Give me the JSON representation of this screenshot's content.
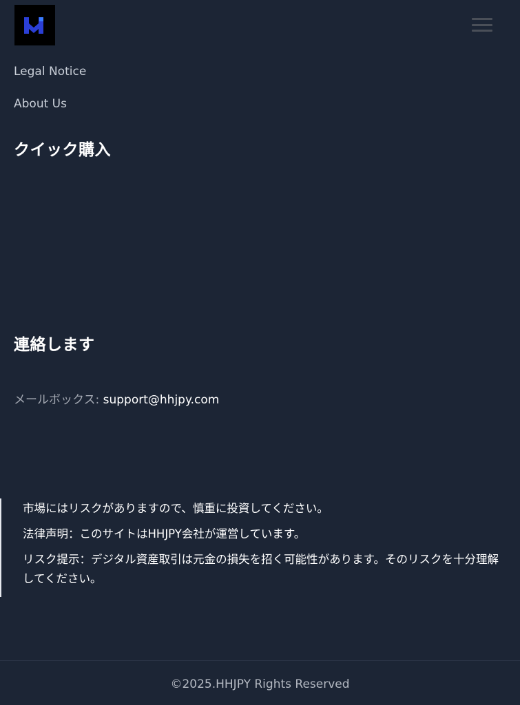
{
  "header": {
    "logo_icon": "hhjpy-logo-icon",
    "menu_icon": "hamburger-menu-icon",
    "colors": {
      "logo_bg": "#000000",
      "logo_mark": "#2b3fd6",
      "menu": "#4a4f58"
    }
  },
  "nav": {
    "legal_notice": "Legal Notice",
    "about_us": "About Us"
  },
  "quick_purchase": {
    "title": "クイック購入"
  },
  "contact": {
    "title": "連絡します",
    "mailbox_label": "メールボックス: ",
    "email": "support@hhjpy.com"
  },
  "risk": {
    "line1": "市場にはリスクがありますので、慎重に投資してください。",
    "line2": "法律声明：このサイトはHHJPY会社が運営しています。",
    "line3": "リスク提示：デジタル資産取引は元金の損失を招く可能性があります。そのリスクを十分理解してください。"
  },
  "footer": {
    "copyright": "©2025.HHJPY Rights Reserved"
  },
  "colors": {
    "page_bg": "#1c2535",
    "text_primary": "#ffffff",
    "text_muted": "#a3a8b2"
  }
}
